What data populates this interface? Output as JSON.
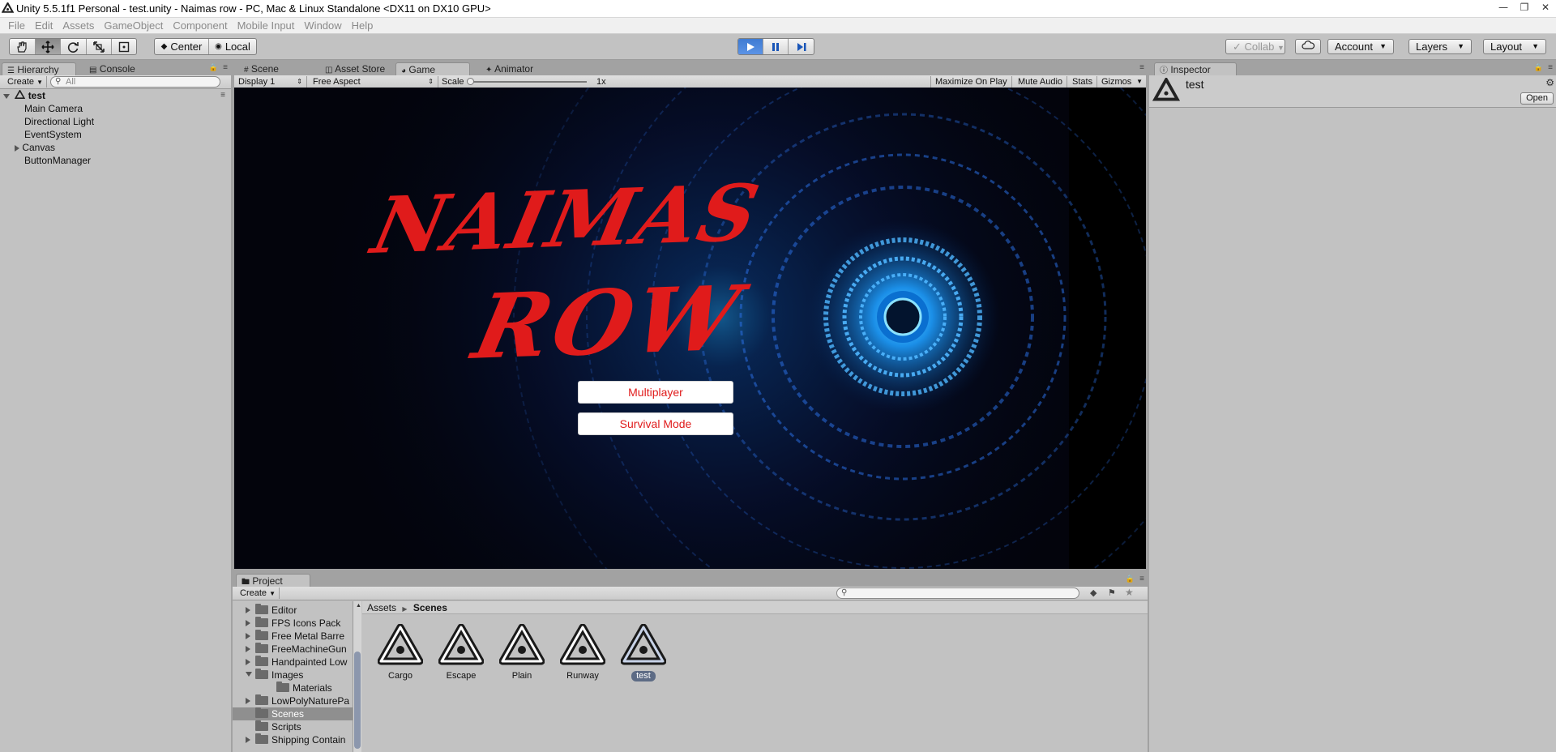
{
  "window": {
    "title": "Unity 5.5.1f1 Personal - test.unity - Naimas row - PC, Mac & Linux Standalone <DX11 on DX10 GPU>",
    "controls": [
      "minimize-icon",
      "restore-icon",
      "close-icon"
    ]
  },
  "menu": [
    "File",
    "Edit",
    "Assets",
    "GameObject",
    "Component",
    "Mobile Input",
    "Window",
    "Help"
  ],
  "toolbar": {
    "tools": [
      "hand-icon",
      "move-icon",
      "rotate-icon",
      "scale-icon",
      "rect-icon"
    ],
    "pivot": "Center",
    "space": "Local",
    "play": [
      "play-icon",
      "pause-icon",
      "step-icon"
    ],
    "collab": "Collab",
    "account": "Account",
    "layers": "Layers",
    "layout": "Layout"
  },
  "hierarchy": {
    "tab": "Hierarchy",
    "console_tab": "Console",
    "create": "Create",
    "search_placeholder": "All",
    "scene": "test",
    "items": [
      "Main Camera",
      "Directional Light",
      "EventSystem",
      "Canvas",
      "ButtonManager"
    ]
  },
  "center_tabs": [
    "Scene",
    "Asset Store",
    "Game",
    "Animator"
  ],
  "game_bar": {
    "display": "Display 1",
    "aspect": "Free Aspect",
    "scale_label": "Scale",
    "scale_value": "1x",
    "scale_level": 0,
    "maximize": "Maximize On Play",
    "mute": "Mute Audio",
    "stats": "Stats",
    "gizmos": "Gizmos"
  },
  "game": {
    "logo_line1": "NAIMAS",
    "logo_line2": "ROW",
    "buttons": [
      "Multiplayer",
      "Survival Mode"
    ],
    "accent": "#e01b1b",
    "background_accent": "#1d8fe0"
  },
  "inspector": {
    "tab": "Inspector",
    "object_name": "test",
    "open_button": "Open"
  },
  "project": {
    "tab": "Project",
    "create": "Create",
    "breadcrumb": [
      "Assets",
      "Scenes"
    ],
    "tree": [
      {
        "label": "Editor",
        "expand": "collapsed",
        "indent": 1
      },
      {
        "label": "FPS Icons Pack",
        "expand": "collapsed",
        "indent": 1
      },
      {
        "label": "Free Metal Barre",
        "expand": "collapsed",
        "indent": 1
      },
      {
        "label": "FreeMachineGun",
        "expand": "collapsed",
        "indent": 1
      },
      {
        "label": "Handpainted Low",
        "expand": "collapsed",
        "indent": 1
      },
      {
        "label": "Images",
        "expand": "expanded",
        "indent": 1
      },
      {
        "label": "Materials",
        "expand": "none",
        "indent": 2
      },
      {
        "label": "LowPolyNaturePa",
        "expand": "collapsed",
        "indent": 1
      },
      {
        "label": "Scenes",
        "expand": "none",
        "indent": 1,
        "selected": true
      },
      {
        "label": "Scripts",
        "expand": "none",
        "indent": 1
      },
      {
        "label": "Shipping Contain",
        "expand": "collapsed",
        "indent": 1
      }
    ],
    "assets": [
      {
        "name": "Cargo",
        "selected": false
      },
      {
        "name": "Escape",
        "selected": false
      },
      {
        "name": "Plain",
        "selected": false
      },
      {
        "name": "Runway",
        "selected": false
      },
      {
        "name": "test",
        "selected": true
      }
    ]
  }
}
